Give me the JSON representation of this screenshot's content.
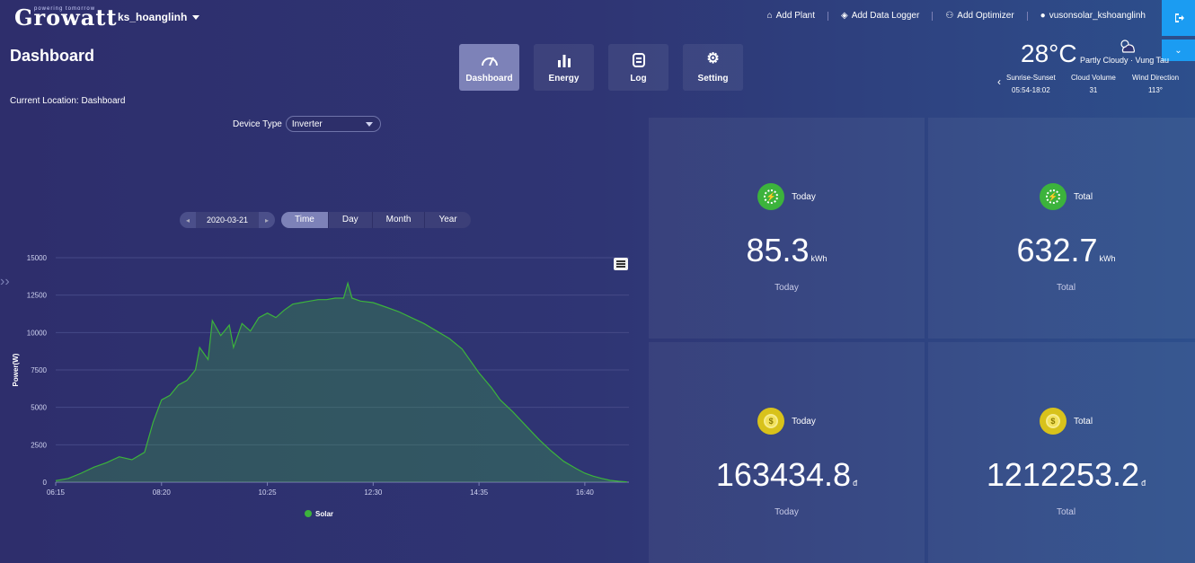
{
  "header": {
    "brand": "Growatt",
    "tagline": "powering tomorrow",
    "username": "ks_hoanglinh",
    "links": {
      "add_plant": "Add Plant",
      "add_data_logger": "Add Data Logger",
      "add_optimizer": "Add Optimizer",
      "account": "vusonsolar_kshoanglinh"
    }
  },
  "page": {
    "title": "Dashboard",
    "breadcrumb": "Current Location: Dashboard"
  },
  "nav_tabs": [
    {
      "label": "Dashboard",
      "icon": "gauge-icon",
      "active": true
    },
    {
      "label": "Energy",
      "icon": "bar-chart-icon",
      "active": false
    },
    {
      "label": "Log",
      "icon": "log-icon",
      "active": false
    },
    {
      "label": "Setting",
      "icon": "gear-icon",
      "active": false
    }
  ],
  "weather": {
    "temperature": "28°C",
    "condition": "Partly Cloudy · Vung Tau",
    "stats": [
      {
        "label": "Sunrise-Sunset",
        "value": "05:54-18:02"
      },
      {
        "label": "Cloud Volume",
        "value": "31"
      },
      {
        "label": "Wind Direction",
        "value": "113°"
      }
    ]
  },
  "filters": {
    "device_type_label": "Device Type",
    "device_type_value": "Inverter",
    "date": "2020-03-21",
    "ranges": [
      "Time",
      "Day",
      "Month",
      "Year"
    ],
    "active_range": "Time"
  },
  "cards": [
    {
      "title": "Today",
      "value": "85.3",
      "unit": "kWh",
      "caption": "Today",
      "icon": "solar-energy-icon",
      "color": "#3cb33c"
    },
    {
      "title": "Total",
      "value": "632.7",
      "unit": "kWh",
      "caption": "Total",
      "icon": "solar-energy-icon",
      "color": "#3cb33c"
    },
    {
      "title": "Today",
      "value": "163434.8",
      "unit": "đ",
      "caption": "Today",
      "icon": "coin-icon",
      "color": "#d8c21b"
    },
    {
      "title": "Total",
      "value": "1212253.2",
      "unit": "đ",
      "caption": "Total",
      "icon": "coin-icon",
      "color": "#d8c21b"
    }
  ],
  "chart_data": {
    "type": "area",
    "ylabel": "Power(W)",
    "ylim": [
      0,
      15000
    ],
    "yticks": [
      "0",
      "2500",
      "5000",
      "7500",
      "10000",
      "12500",
      "15000"
    ],
    "xticks": [
      "06:15",
      "08:20",
      "10:25",
      "12:30",
      "14:35",
      "16:40"
    ],
    "legend_position": "bottom",
    "grid": true,
    "series": [
      {
        "name": "Solar",
        "color": "#3cb33c",
        "x": [
          "06:15",
          "06:30",
          "06:45",
          "07:00",
          "07:15",
          "07:30",
          "07:45",
          "08:00",
          "08:10",
          "08:20",
          "08:30",
          "08:40",
          "08:50",
          "09:00",
          "09:05",
          "09:15",
          "09:20",
          "09:30",
          "09:40",
          "09:45",
          "09:55",
          "10:05",
          "10:15",
          "10:25",
          "10:35",
          "10:45",
          "10:55",
          "11:05",
          "11:15",
          "11:25",
          "11:35",
          "11:45",
          "11:55",
          "12:00",
          "12:05",
          "12:15",
          "12:30",
          "12:45",
          "13:00",
          "13:15",
          "13:30",
          "13:45",
          "14:00",
          "14:15",
          "14:35",
          "14:50",
          "15:00",
          "15:15",
          "15:30",
          "15:45",
          "16:00",
          "16:15",
          "16:30",
          "16:40",
          "16:50",
          "17:00",
          "17:10",
          "17:20",
          "17:30"
        ],
        "y": [
          100,
          250,
          600,
          1000,
          1300,
          1700,
          1500,
          2000,
          4000,
          5500,
          5800,
          6500,
          6800,
          7500,
          9000,
          8200,
          10800,
          9800,
          10500,
          9000,
          10600,
          10100,
          11000,
          11300,
          11000,
          11500,
          11900,
          12000,
          12100,
          12200,
          12200,
          12300,
          12300,
          13300,
          12300,
          12100,
          12000,
          11700,
          11400,
          11000,
          10600,
          10100,
          9600,
          8900,
          7300,
          6300,
          5500,
          4700,
          3800,
          2900,
          2100,
          1400,
          900,
          600,
          400,
          250,
          120,
          60,
          20
        ]
      }
    ]
  }
}
